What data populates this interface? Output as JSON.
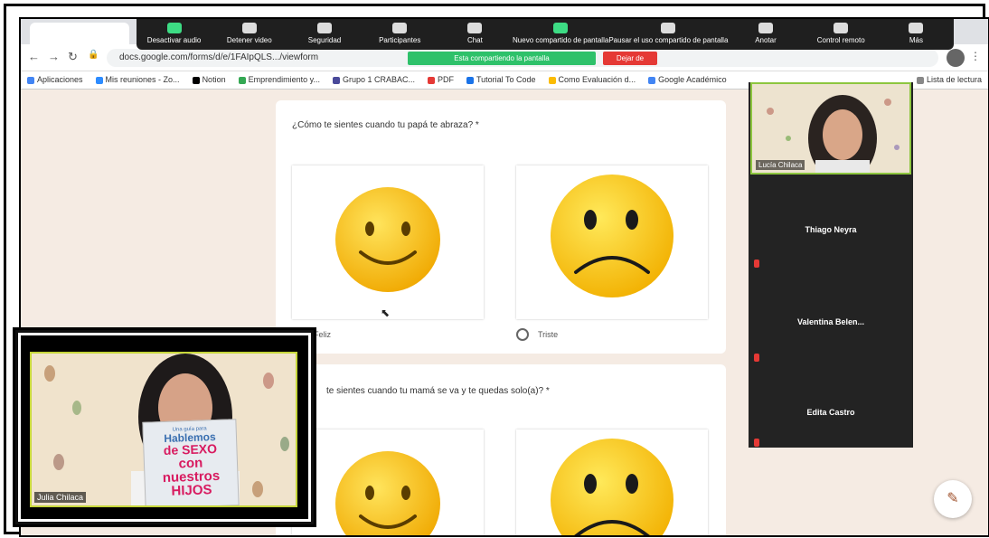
{
  "browser": {
    "url": "docs.google.com/forms/d/e/1FAIpQLS.../viewform",
    "bookmarks": [
      {
        "label": "Aplicaciones",
        "color": "#4285f4"
      },
      {
        "label": "Mis reuniones - Zo...",
        "color": "#2d8cff"
      },
      {
        "label": "Notion",
        "color": "#000000"
      },
      {
        "label": "Emprendimiento y...",
        "color": "#34a853"
      },
      {
        "label": "Grupo 1 CRABAC...",
        "color": "#4a4a9a"
      },
      {
        "label": "PDF",
        "color": "#e53935"
      },
      {
        "label": "Tutorial To Code",
        "color": "#1a73e8"
      },
      {
        "label": "Como Evaluación d...",
        "color": "#fbbc04"
      },
      {
        "label": "Google Académico",
        "color": "#4285f4"
      }
    ],
    "reading_list": "Lista de lectura"
  },
  "zoom_toolbar": {
    "buttons": [
      {
        "label": "Desactivar audio",
        "icon": "mic-icon"
      },
      {
        "label": "Detener video",
        "icon": "camera-icon"
      },
      {
        "label": "Seguridad",
        "icon": "shield-icon"
      },
      {
        "label": "Participantes",
        "icon": "people-icon"
      },
      {
        "label": "Chat",
        "icon": "chat-icon"
      },
      {
        "label": "Nuevo compartido de pantalla",
        "icon": "share-screen-icon"
      },
      {
        "label": "Pausar el uso compartido de pantalla",
        "icon": "pause-icon"
      },
      {
        "label": "Anotar",
        "icon": "pen-icon"
      },
      {
        "label": "Control remoto",
        "icon": "remote-icon"
      },
      {
        "label": "Más",
        "icon": "more-icon"
      }
    ],
    "sharing_banner": "Esta compartiendo la pantalla",
    "stop_label": "Dejar de"
  },
  "form": {
    "q1": {
      "text": "¿Cómo te sientes cuando tu papá te abraza? *",
      "options": [
        {
          "label": "Feliz",
          "face": "happy"
        },
        {
          "label": "Triste",
          "face": "sad"
        }
      ]
    },
    "q2": {
      "text": "te sientes cuando tu mamá se va y te quedas solo(a)? *"
    }
  },
  "participants": {
    "self_label": "Lucía Chilaca",
    "list": [
      "Thiago Neyra",
      "Valentina Belen...",
      "Edita Castro"
    ]
  },
  "pip": {
    "name_label": "Julia Chilaca",
    "book": {
      "line1": "Una guía para",
      "line2": "Hablemos",
      "line3": "de SEXO",
      "line4": "con nuestros HIJOS"
    }
  }
}
